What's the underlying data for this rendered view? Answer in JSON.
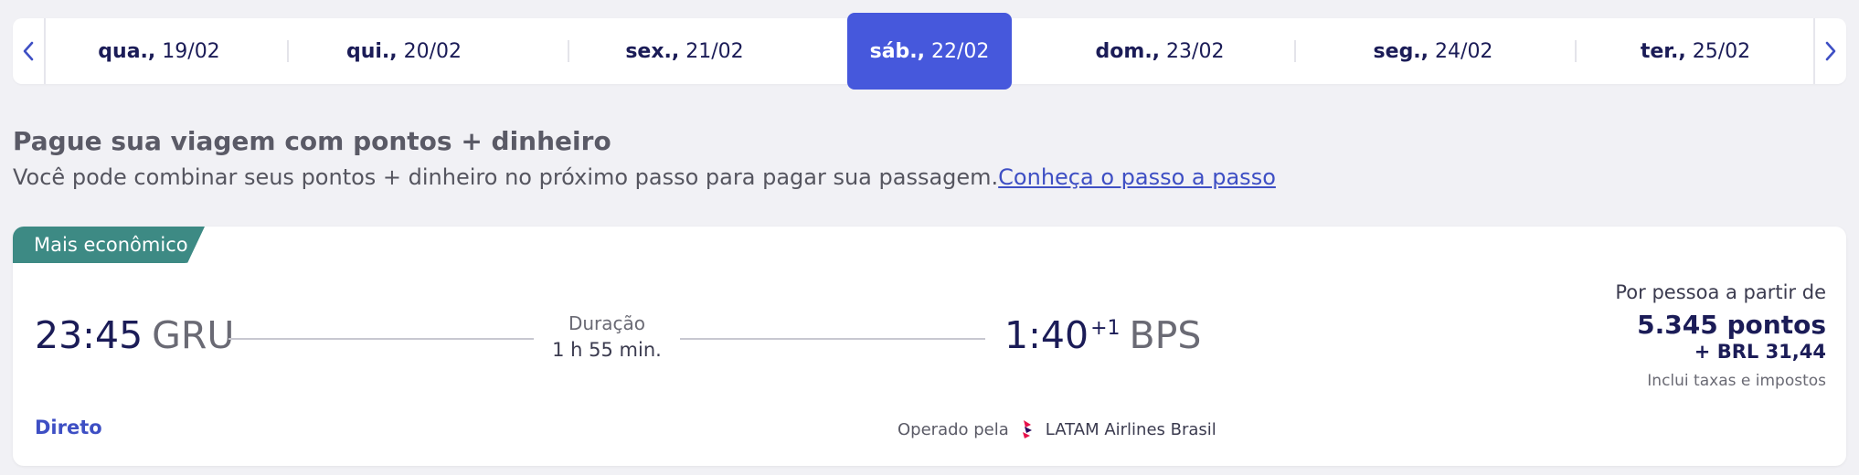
{
  "date_carousel": {
    "prev_icon": "chevron-left-icon",
    "next_icon": "chevron-right-icon",
    "dates": [
      {
        "dow": "qua.,",
        "date": "19/02",
        "selected": false
      },
      {
        "dow": "qui.,",
        "date": "20/02",
        "selected": false
      },
      {
        "dow": "sex.,",
        "date": "21/02",
        "selected": false
      },
      {
        "dow": "sáb.,",
        "date": "22/02",
        "selected": true
      },
      {
        "dow": "dom.,",
        "date": "23/02",
        "selected": false
      },
      {
        "dow": "seg.,",
        "date": "24/02",
        "selected": false
      },
      {
        "dow": "ter.,",
        "date": "25/02",
        "selected": false
      }
    ]
  },
  "section": {
    "title": "Pague sua viagem com pontos + dinheiro",
    "subtitle": "Você pode combinar seus pontos + dinheiro no próximo passo para pagar sua passagem.",
    "link": "Conheça o passo a passo"
  },
  "flight": {
    "badge": "Mais econômico",
    "departure_time": "23:45",
    "departure_airport": "GRU",
    "duration_label": "Duração",
    "duration": "1 h 55 min.",
    "arrival_time": "1:40",
    "arrival_day_offset": "+1",
    "arrival_airport": "BPS",
    "stops": "Direto",
    "operated_by_label": "Operado pela",
    "airline": "LATAM Airlines Brasil",
    "price": {
      "per_person": "Por pessoa a partir de",
      "points": "5.345 pontos",
      "cash": "+ BRL 31,44",
      "taxes_note": "Inclui taxas e impostos"
    }
  },
  "colors": {
    "accent": "#4658dc",
    "navy": "#1b1c57",
    "badge": "#3d8a84",
    "link": "#3e4fc4",
    "background": "#f1f1f5"
  }
}
